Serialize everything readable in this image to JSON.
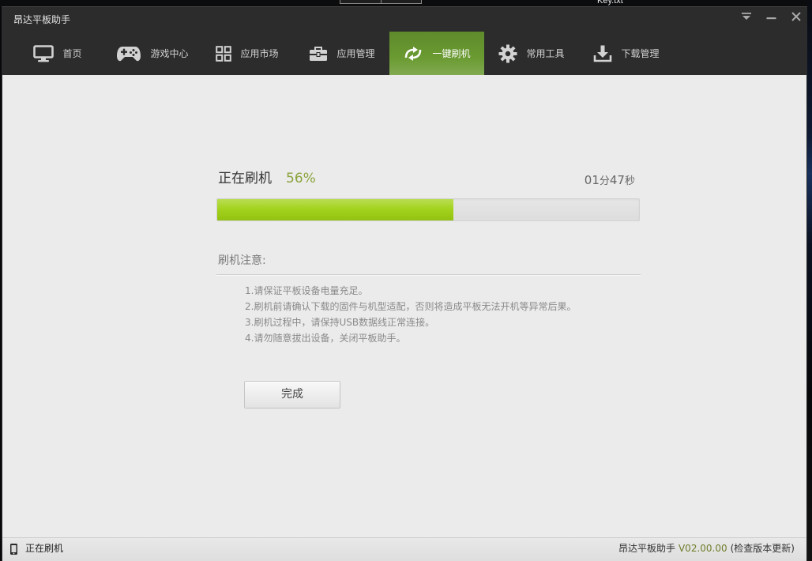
{
  "desktop": {
    "file_label": "Key.txt"
  },
  "window": {
    "title": "昂达平板助手"
  },
  "nav": {
    "items": [
      {
        "label": "首页",
        "icon": "monitor-icon",
        "active": false
      },
      {
        "label": "游戏中心",
        "icon": "gamepad-icon",
        "active": false
      },
      {
        "label": "应用市场",
        "icon": "app-grid-icon",
        "active": false
      },
      {
        "label": "应用管理",
        "icon": "toolbox-icon",
        "active": false
      },
      {
        "label": "一键刷机",
        "icon": "flash-refresh-icon",
        "active": true
      },
      {
        "label": "常用工具",
        "icon": "gear-icon",
        "active": false
      },
      {
        "label": "下载管理",
        "icon": "download-icon",
        "active": false
      }
    ]
  },
  "flash": {
    "status_label": "正在刷机",
    "percent_text": "56%",
    "progress": 0.56,
    "timer": {
      "minutes": "01",
      "minutes_unit": "分",
      "seconds": "47",
      "seconds_unit": "秒"
    },
    "notes_title": "刷机注意:",
    "notes": [
      "1.请保证平板设备电量充足。",
      "2.刷机前请确认下载的固件与机型适配，否则将造成平板无法开机等异常后果。",
      "3.刷机过程中，请保持USB数据线正常连接。",
      "4.请勿随意拔出设备，关闭平板助手。"
    ],
    "done_button": "完成"
  },
  "statusbar": {
    "status_text": "正在刷机",
    "app_name": "昂达平板助手",
    "version": "V02.00.00",
    "check_update": "(检查版本更新)"
  },
  "colors": {
    "active_tab": "#6a9a31",
    "progress_fill": "#9fd112",
    "percent_text": "#8aa33c",
    "version_text": "#6f7d2b"
  }
}
